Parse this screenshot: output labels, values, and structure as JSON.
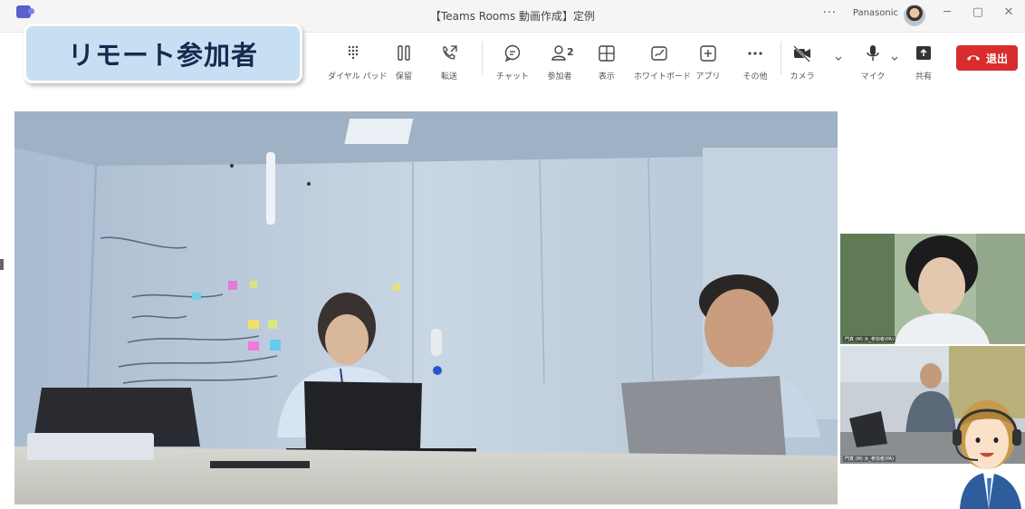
{
  "window": {
    "title": "【Teams Rooms 動画作成】定例",
    "more": "···",
    "org": "Panasonic",
    "minimize": "─",
    "maximize": "▢",
    "close": "✕"
  },
  "toolbar": {
    "items": [
      {
        "label": "ダイヤル パッド",
        "icon": "dialpad-icon"
      },
      {
        "label": "保留",
        "icon": "hold-icon"
      },
      {
        "label": "転送",
        "icon": "transfer-icon"
      },
      {
        "label": "チャット",
        "icon": "chat-icon"
      },
      {
        "label": "参加者",
        "icon": "participants-icon",
        "count": "2"
      },
      {
        "label": "表示",
        "icon": "view-icon"
      },
      {
        "label": "ホワイトボード",
        "icon": "whiteboard-icon"
      },
      {
        "label": "アプリ",
        "icon": "apps-icon"
      },
      {
        "label": "その他",
        "icon": "more-icon"
      },
      {
        "label": "カメラ",
        "icon": "camera-off-icon"
      },
      {
        "label": "マイク",
        "icon": "mic-icon"
      },
      {
        "label": "共有",
        "icon": "share-icon"
      }
    ],
    "leave_label": "退出"
  },
  "banner": {
    "text": "リモート参加者"
  },
  "participants": {
    "thumb1_name": "門真 (M) 大_参加者(PA)",
    "thumb2_name": "門真 (M) 大_参加者(PA)"
  },
  "colors": {
    "leave": "#d92c2c",
    "banner_bg": "#c7dff3",
    "banner_text": "#162a4e",
    "teams_accent": "#5b5fc7"
  }
}
